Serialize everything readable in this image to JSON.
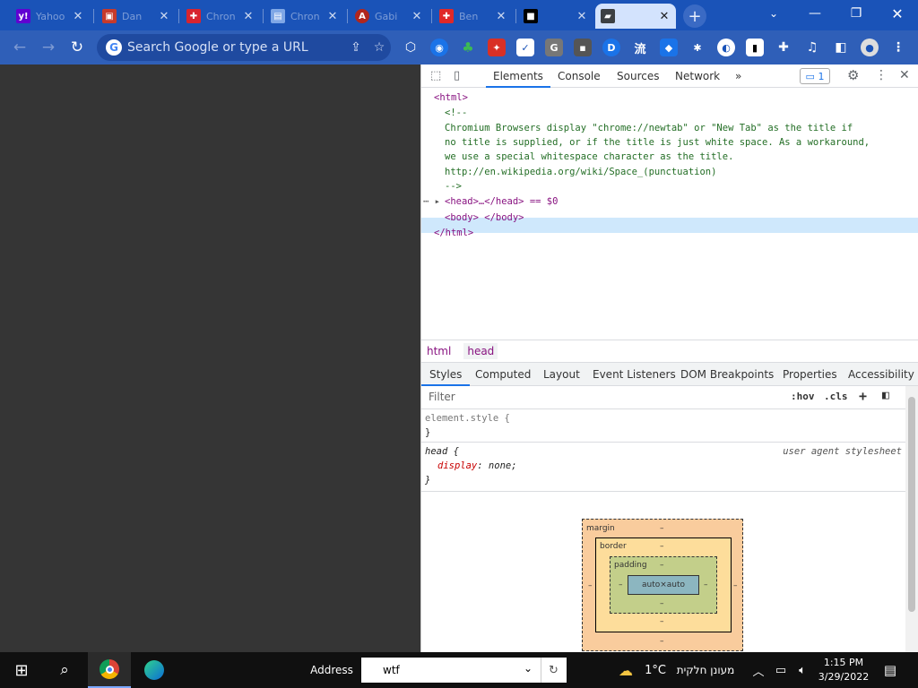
{
  "tabs": [
    {
      "title": "Yahoo",
      "fav_glyph": "y!",
      "fav_color": "#6001d2"
    },
    {
      "title": "Dan",
      "fav_glyph": "▣",
      "fav_color": "#c63a2b"
    },
    {
      "title": "Chron",
      "fav_glyph": "✚",
      "fav_color": "#d8242f"
    },
    {
      "title": "Chron",
      "fav_glyph": "▤",
      "fav_color": "#7fa7e6"
    },
    {
      "title": "Gabi",
      "fav_glyph": "A",
      "fav_color": "#b0261e"
    },
    {
      "title": "Ben",
      "fav_glyph": "✚",
      "fav_color": "#e02828"
    },
    {
      "title": "",
      "fav_glyph": "■",
      "fav_color": "#000000"
    },
    {
      "title": "",
      "fav_glyph": "▰",
      "fav_color": "#3c4043"
    }
  ],
  "omnibox": {
    "placeholder": "Search Google or type a URL"
  },
  "devtools": {
    "tabs": [
      "Elements",
      "Console",
      "Sources",
      "Network"
    ],
    "more": "»",
    "issues_count": "1",
    "dom_lines": [
      "<html>",
      "<!--",
      "Chromium Browsers display \"chrome://newtab\" or \"New Tab\" as the title if",
      "no title is supplied, or if the title is just white space. As a workaround,",
      "we use a special whitespace character as the title.",
      "http://en.wikipedia.org/wiki/Space_(punctuation)",
      "-->",
      "<head>…</head> == $0",
      "<body> </body>",
      "</html>"
    ],
    "breadcrumbs": [
      "html",
      "head"
    ],
    "subtabs": [
      "Styles",
      "Computed",
      "Layout",
      "Event Listeners",
      "DOM Breakpoints",
      "Properties",
      "Accessibility"
    ],
    "filter_placeholder": "Filter",
    "hov": ":hov",
    "cls": ".cls",
    "rules": {
      "element_style_open": "element.style {",
      "close": "}",
      "head_selector": "head {",
      "ua_label": "user agent stylesheet",
      "prop": "display",
      "val": "none;"
    },
    "box_model": {
      "margin": "margin",
      "border": "border",
      "padding": "padding",
      "content": "auto×auto",
      "dash": "–"
    }
  },
  "taskbar": {
    "address_label": "Address",
    "address_value": "wtf",
    "weather": "1°C",
    "weather_text": "מעונן חלקית",
    "time": "1:15 PM",
    "date": "3/29/2022"
  }
}
